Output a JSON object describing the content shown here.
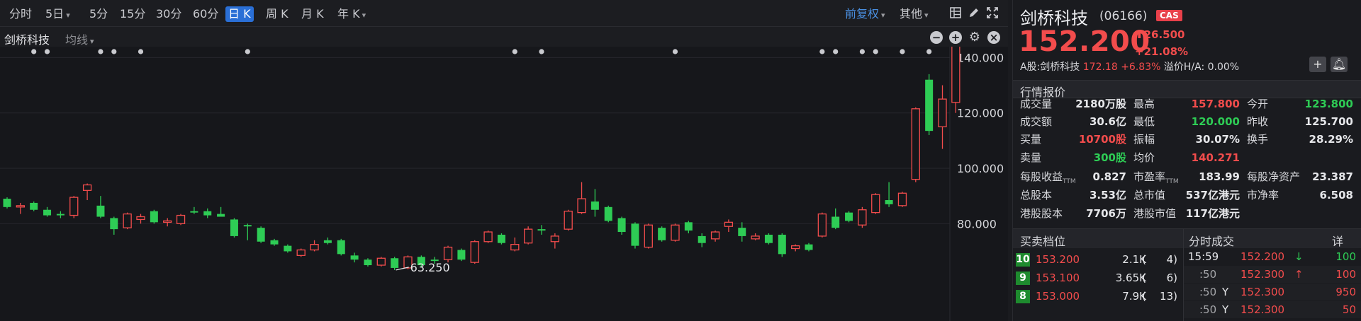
{
  "toolbar": {
    "periods": [
      "分时",
      "5日",
      "5分",
      "15分",
      "30分",
      "60分",
      "日 K",
      "周 K",
      "月 K",
      "年 K"
    ],
    "active_period": "日 K",
    "adjust_label": "前复权",
    "others_label": "其他"
  },
  "chart_header": {
    "stock_name": "剑桥科技",
    "indicator_label": "均线"
  },
  "chart_data": {
    "type": "candlestick",
    "title": "",
    "ylim": [
      60,
      165
    ],
    "y_ticks": [
      80,
      100,
      120,
      140
    ],
    "y_tick_labels": [
      "80.000",
      "100.000",
      "120.000",
      "140.000"
    ],
    "high_marker": 157.8,
    "high_marker_label": "157.800",
    "low_marker": 63.25,
    "low_marker_label": "63.250",
    "up_color": "#f24c4c",
    "down_color": "#2ecc55",
    "candles": [
      {
        "o": 89.0,
        "h": 89.5,
        "l": 85.5,
        "c": 86.0
      },
      {
        "o": 86.0,
        "h": 87.5,
        "l": 83.5,
        "c": 86.5
      },
      {
        "o": 87.5,
        "h": 88.0,
        "l": 84.5,
        "c": 85.0
      },
      {
        "o": 85.0,
        "h": 86.0,
        "l": 82.5,
        "c": 83.0
      },
      {
        "o": 83.5,
        "h": 84.5,
        "l": 82.0,
        "c": 83.0
      },
      {
        "o": 83.0,
        "h": 90.0,
        "l": 82.0,
        "c": 89.5
      },
      {
        "o": 92.0,
        "h": 94.5,
        "l": 88.5,
        "c": 94.0
      },
      {
        "o": 86.5,
        "h": 90.0,
        "l": 82.0,
        "c": 82.5
      },
      {
        "o": 82.0,
        "h": 82.5,
        "l": 76.0,
        "c": 78.0
      },
      {
        "o": 78.5,
        "h": 84.0,
        "l": 78.0,
        "c": 83.5
      },
      {
        "o": 81.5,
        "h": 83.5,
        "l": 80.0,
        "c": 82.5
      },
      {
        "o": 84.5,
        "h": 85.0,
        "l": 80.0,
        "c": 80.5
      },
      {
        "o": 80.5,
        "h": 82.0,
        "l": 79.0,
        "c": 81.0
      },
      {
        "o": 80.0,
        "h": 83.5,
        "l": 79.5,
        "c": 83.0
      },
      {
        "o": 84.5,
        "h": 86.0,
        "l": 83.5,
        "c": 84.0
      },
      {
        "o": 84.5,
        "h": 85.5,
        "l": 82.0,
        "c": 83.0
      },
      {
        "o": 83.5,
        "h": 86.0,
        "l": 82.5,
        "c": 82.5
      },
      {
        "o": 81.5,
        "h": 82.0,
        "l": 75.0,
        "c": 75.5
      },
      {
        "o": 79.5,
        "h": 80.0,
        "l": 74.0,
        "c": 79.0
      },
      {
        "o": 78.5,
        "h": 79.0,
        "l": 73.0,
        "c": 73.5
      },
      {
        "o": 74.0,
        "h": 74.5,
        "l": 72.0,
        "c": 72.5
      },
      {
        "o": 72.0,
        "h": 72.5,
        "l": 69.5,
        "c": 70.0
      },
      {
        "o": 68.5,
        "h": 71.0,
        "l": 68.0,
        "c": 70.5
      },
      {
        "o": 70.5,
        "h": 74.0,
        "l": 70.0,
        "c": 72.5
      },
      {
        "o": 74.0,
        "h": 75.0,
        "l": 72.5,
        "c": 73.0
      },
      {
        "o": 74.0,
        "h": 74.5,
        "l": 68.5,
        "c": 69.0
      },
      {
        "o": 68.5,
        "h": 69.5,
        "l": 66.0,
        "c": 67.0
      },
      {
        "o": 67.0,
        "h": 67.5,
        "l": 64.5,
        "c": 65.0
      },
      {
        "o": 65.0,
        "h": 68.0,
        "l": 64.5,
        "c": 67.5
      },
      {
        "o": 67.5,
        "h": 68.0,
        "l": 63.25,
        "c": 64.0
      },
      {
        "o": 64.0,
        "h": 68.5,
        "l": 63.5,
        "c": 68.0
      },
      {
        "o": 68.0,
        "h": 68.5,
        "l": 64.5,
        "c": 65.0
      },
      {
        "o": 67.0,
        "h": 68.0,
        "l": 65.5,
        "c": 66.5
      },
      {
        "o": 67.0,
        "h": 72.0,
        "l": 66.0,
        "c": 71.5
      },
      {
        "o": 70.5,
        "h": 71.0,
        "l": 66.5,
        "c": 67.0
      },
      {
        "o": 66.0,
        "h": 74.0,
        "l": 65.5,
        "c": 73.5
      },
      {
        "o": 73.5,
        "h": 77.5,
        "l": 73.0,
        "c": 77.0
      },
      {
        "o": 76.0,
        "h": 76.5,
        "l": 72.5,
        "c": 73.0
      },
      {
        "o": 70.5,
        "h": 75.0,
        "l": 70.0,
        "c": 72.5
      },
      {
        "o": 73.0,
        "h": 79.0,
        "l": 72.5,
        "c": 78.0
      },
      {
        "o": 78.0,
        "h": 79.5,
        "l": 76.0,
        "c": 77.5
      },
      {
        "o": 73.5,
        "h": 76.5,
        "l": 71.0,
        "c": 75.5
      },
      {
        "o": 78.0,
        "h": 85.0,
        "l": 77.5,
        "c": 84.5
      },
      {
        "o": 84.0,
        "h": 95.0,
        "l": 83.5,
        "c": 89.0
      },
      {
        "o": 88.0,
        "h": 92.5,
        "l": 82.5,
        "c": 85.0
      },
      {
        "o": 86.0,
        "h": 86.5,
        "l": 80.5,
        "c": 81.0
      },
      {
        "o": 82.0,
        "h": 82.5,
        "l": 76.0,
        "c": 77.0
      },
      {
        "o": 80.0,
        "h": 80.5,
        "l": 71.0,
        "c": 72.0
      },
      {
        "o": 71.5,
        "h": 80.0,
        "l": 71.0,
        "c": 79.5
      },
      {
        "o": 78.5,
        "h": 79.0,
        "l": 73.5,
        "c": 74.0
      },
      {
        "o": 74.0,
        "h": 80.0,
        "l": 73.5,
        "c": 79.5
      },
      {
        "o": 80.5,
        "h": 81.0,
        "l": 76.5,
        "c": 77.5
      },
      {
        "o": 75.5,
        "h": 76.5,
        "l": 71.5,
        "c": 73.0
      },
      {
        "o": 74.5,
        "h": 77.5,
        "l": 73.5,
        "c": 77.0
      },
      {
        "o": 79.0,
        "h": 81.5,
        "l": 77.0,
        "c": 80.5
      },
      {
        "o": 78.5,
        "h": 80.5,
        "l": 73.5,
        "c": 75.5
      },
      {
        "o": 74.5,
        "h": 76.5,
        "l": 74.0,
        "c": 75.5
      },
      {
        "o": 76.0,
        "h": 76.5,
        "l": 72.5,
        "c": 73.0
      },
      {
        "o": 76.0,
        "h": 76.5,
        "l": 68.0,
        "c": 69.0
      },
      {
        "o": 71.0,
        "h": 72.5,
        "l": 70.0,
        "c": 72.0
      },
      {
        "o": 72.5,
        "h": 73.0,
        "l": 70.0,
        "c": 70.5
      },
      {
        "o": 75.5,
        "h": 84.0,
        "l": 75.0,
        "c": 83.5
      },
      {
        "o": 82.5,
        "h": 85.5,
        "l": 78.0,
        "c": 78.5
      },
      {
        "o": 84.0,
        "h": 84.5,
        "l": 80.5,
        "c": 81.0
      },
      {
        "o": 79.5,
        "h": 86.0,
        "l": 78.5,
        "c": 85.0
      },
      {
        "o": 84.0,
        "h": 91.0,
        "l": 83.5,
        "c": 90.5
      },
      {
        "o": 88.5,
        "h": 95.0,
        "l": 86.0,
        "c": 87.0
      },
      {
        "o": 86.5,
        "h": 91.5,
        "l": 86.0,
        "c": 91.0
      },
      {
        "o": 96.0,
        "h": 122.0,
        "l": 95.0,
        "c": 121.5
      },
      {
        "o": 132.0,
        "h": 134.0,
        "l": 112.0,
        "c": 113.5
      },
      {
        "o": 115.0,
        "h": 130.0,
        "l": 107.0,
        "c": 125.0
      },
      {
        "o": 123.8,
        "h": 157.8,
        "l": 120.0,
        "c": 152.2
      }
    ],
    "event_dots": [
      2,
      3,
      7,
      8,
      10,
      18,
      38,
      40,
      50,
      61,
      62,
      64,
      65,
      67,
      69
    ]
  },
  "quote": {
    "name": "剑桥科技",
    "code": "(06166)",
    "badge": "CAS",
    "price": "152.200",
    "change": "26.500",
    "change_pct": "+21.08%",
    "ashare_label": "A股:剑桥科技",
    "ashare_price": "172.18",
    "ashare_pct": "+6.83%",
    "premium": "溢价H/A: 0.00%"
  },
  "sections": {
    "quote_title": "行情报价",
    "order_title": "买卖档位",
    "trade_title": "分时成交",
    "detail_label": "详"
  },
  "stats": [
    {
      "label": "成交量",
      "value": "2180万股",
      "color": "white"
    },
    {
      "label": "最高",
      "value": "157.800",
      "color": "red"
    },
    {
      "label": "今开",
      "value": "123.800",
      "color": "green"
    },
    {
      "label": "成交额",
      "value": "30.6亿",
      "color": "white"
    },
    {
      "label": "最低",
      "value": "120.000",
      "color": "green"
    },
    {
      "label": "昨收",
      "value": "125.700",
      "color": "white"
    },
    {
      "label": "买量",
      "value": "10700股",
      "color": "red"
    },
    {
      "label": "振幅",
      "value": "30.07%",
      "color": "white"
    },
    {
      "label": "换手",
      "value": "28.29%",
      "color": "white"
    },
    {
      "label": "卖量",
      "value": "300股",
      "color": "green"
    },
    {
      "label": "均价",
      "value": "140.271",
      "color": "red"
    },
    {
      "label": "",
      "value": "",
      "color": "white"
    },
    {
      "label": "每股收益",
      "ttm": "TTM",
      "value": "0.827",
      "color": "white"
    },
    {
      "label": "市盈率",
      "ttm": "TTM",
      "value": "183.99",
      "color": "white"
    },
    {
      "label": "每股净资产",
      "value": "23.387",
      "color": "white"
    },
    {
      "label": "总股本",
      "value": "3.53亿",
      "color": "white"
    },
    {
      "label": "总市值",
      "value": "537亿港元",
      "color": "white"
    },
    {
      "label": "市净率",
      "value": "6.508",
      "color": "white"
    },
    {
      "label": "港股股本",
      "value": "7706万",
      "color": "white"
    },
    {
      "label": "港股市值",
      "value": "117亿港元",
      "color": "white"
    },
    {
      "label": "",
      "value": "",
      "color": "white"
    }
  ],
  "orders": [
    {
      "level": "10",
      "price": "153.200",
      "volume": "2.1K",
      "count": "(      4)"
    },
    {
      "level": "9",
      "price": "153.100",
      "volume": "3.65K",
      "count": "(      6)"
    },
    {
      "level": "8",
      "price": "153.000",
      "volume": "7.9K",
      "count": "(    13)"
    }
  ],
  "trades": [
    {
      "time": "15:59",
      "type": "",
      "price": "152.200",
      "arrow": "↓",
      "arrow_color": "green",
      "volume": "100",
      "vol_color": "green"
    },
    {
      "time": ":50",
      "type": "",
      "price": "152.300",
      "arrow": "↑",
      "arrow_color": "red",
      "volume": "100",
      "vol_color": "red"
    },
    {
      "time": ":50",
      "type": "Y",
      "price": "152.300",
      "arrow": "",
      "arrow_color": "red",
      "volume": "950",
      "vol_color": "red"
    },
    {
      "time": ":50",
      "type": "Y",
      "price": "152.300",
      "arrow": "",
      "arrow_color": "red",
      "volume": "50",
      "vol_color": "red"
    }
  ]
}
